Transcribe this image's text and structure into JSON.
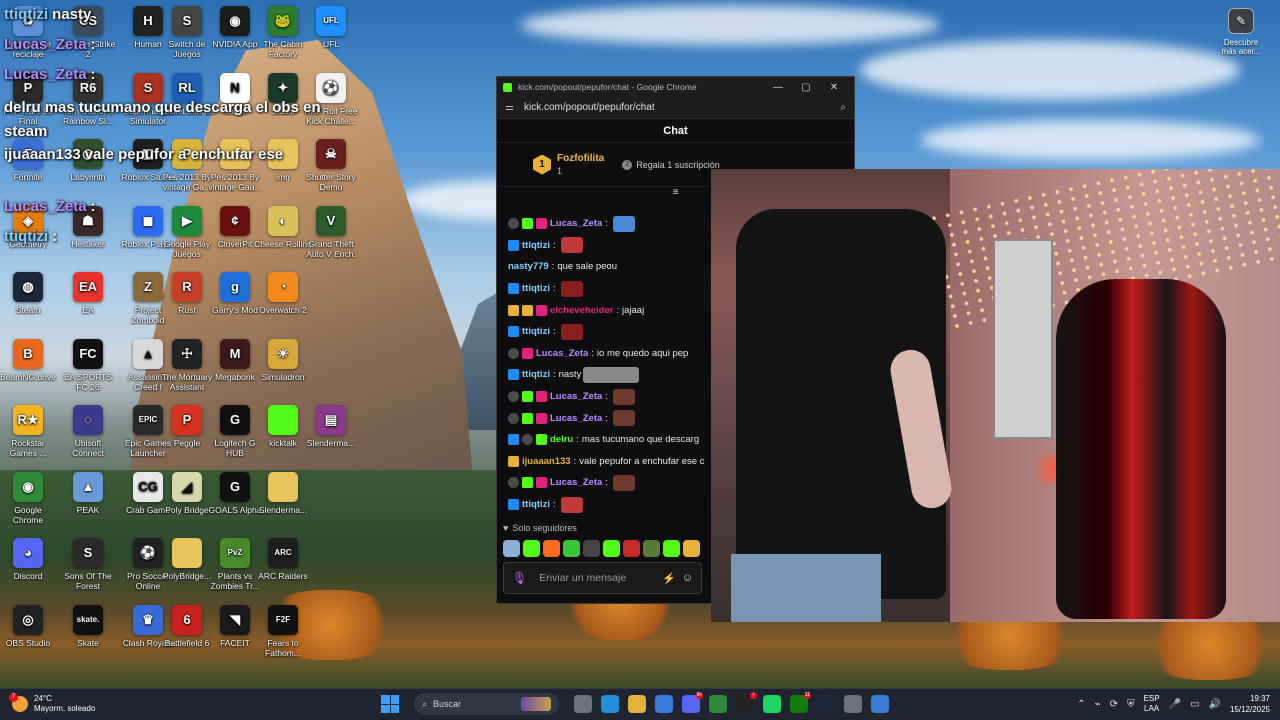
{
  "desktop_icons": [
    {
      "label": "Papelera de reciclaje",
      "icon": "recycle-bin-icon",
      "color": "#5b8fd6",
      "glyph": "♻",
      "col": 0,
      "row": 0
    },
    {
      "label": "Counter-Strike 2",
      "icon": "cs2-icon",
      "color": "#3b4a5c",
      "glyph": "CS",
      "col": 1,
      "row": 0
    },
    {
      "label": "Human",
      "icon": "human-icon",
      "color": "#222222",
      "glyph": "H",
      "col": 2,
      "row": 0
    },
    {
      "label": "Switch de Juegos",
      "icon": "switch-icon",
      "color": "#444444",
      "glyph": "S",
      "col": 2.65,
      "row": 0
    },
    {
      "label": "NVIDIA App",
      "icon": "nvidia-icon",
      "color": "#1c1c1c",
      "glyph": "◉",
      "col": 3.45,
      "row": 0
    },
    {
      "label": "The Cabin Factory",
      "icon": "frog-icon",
      "color": "#2e7a2e",
      "glyph": "🐸",
      "col": 4.25,
      "row": 0
    },
    {
      "label": "UFL",
      "icon": "ufl-icon",
      "color": "#1e90ff",
      "glyph": "UFL",
      "col": 5.05,
      "row": 0
    },
    {
      "label": "PTP Icaro 90 Final",
      "icon": "ptp-icon",
      "color": "#2a2a2a",
      "glyph": "P",
      "col": 0,
      "row": 1
    },
    {
      "label": "Tom Clancy's Rainbow Si...",
      "icon": "rainbow-six-icon",
      "color": "#333333",
      "glyph": "R6",
      "col": 1,
      "row": 1
    },
    {
      "label": "Supermarket Simulator",
      "icon": "supermarket-icon",
      "color": "#aa3322",
      "glyph": "S",
      "col": 2,
      "row": 1
    },
    {
      "label": "Rocket League",
      "icon": "rocket-league-icon",
      "color": "#1d5fb5",
      "glyph": "RL",
      "col": 2.65,
      "row": 1
    },
    {
      "label": "Notion",
      "icon": "notion-icon",
      "color": "#ffffff",
      "glyph": "N",
      "col": 3.45,
      "row": 1
    },
    {
      "label": "Studio",
      "icon": "studio-icon",
      "color": "#1a3a2a",
      "glyph": "✦",
      "col": 4.25,
      "row": 1
    },
    {
      "label": "Kick Roll Free Kick Challe...",
      "icon": "football-icon",
      "color": "#f2f2f2",
      "glyph": "⚽",
      "col": 5.05,
      "row": 1
    },
    {
      "label": "Fortnite",
      "icon": "fortnite-icon",
      "color": "#3b6fd8",
      "glyph": "F",
      "col": 0,
      "row": 2
    },
    {
      "label": "Labyrinth",
      "icon": "labyrinth-icon",
      "color": "#2f4f2f",
      "glyph": "◎",
      "col": 1,
      "row": 2
    },
    {
      "label": "Roblox Studio",
      "icon": "roblox-studio-icon",
      "color": "#1f1f1f",
      "glyph": "◧",
      "col": 2,
      "row": 2
    },
    {
      "label": "Pes 2013 By vintage Ga...",
      "icon": "pes-icon",
      "color": "#d8b33a",
      "glyph": "P",
      "col": 2.65,
      "row": 2
    },
    {
      "label": "Pes 2013 By vintage Gaa...",
      "icon": "folder-icon",
      "color": "#e8c25a",
      "glyph": "",
      "col": 3.45,
      "row": 2
    },
    {
      "label": "img",
      "icon": "folder-icon",
      "color": "#e8c25a",
      "glyph": "",
      "col": 4.25,
      "row": 2
    },
    {
      "label": "Shutter Story Demo",
      "icon": "shutter-story-icon",
      "color": "#6a1e1e",
      "glyph": "☠",
      "col": 5.05,
      "row": 2
    },
    {
      "label": "Geometry",
      "icon": "blender-icon",
      "color": "#e87d0d",
      "glyph": "◈",
      "col": 0,
      "row": 3
    },
    {
      "label": "Helltaker",
      "icon": "hell-icon",
      "color": "#3a2a2a",
      "glyph": "☗",
      "col": 1,
      "row": 3
    },
    {
      "label": "Roblox Player",
      "icon": "roblox-icon",
      "color": "#2b6cf2",
      "glyph": "◼",
      "col": 2,
      "row": 3
    },
    {
      "label": "Google Play Juegos",
      "icon": "google-play-icon",
      "color": "#1e8a3c",
      "glyph": "▶",
      "col": 2.65,
      "row": 3
    },
    {
      "label": "CloverPit",
      "icon": "cloverpit-icon",
      "color": "#6a1010",
      "glyph": "¢",
      "col": 3.45,
      "row": 3
    },
    {
      "label": "Cheese Rolling",
      "icon": "cheese-icon",
      "color": "#d8c05a",
      "glyph": "◐",
      "col": 4.25,
      "row": 3
    },
    {
      "label": "Grand Theft Auto V Ench.",
      "icon": "gta-icon",
      "color": "#2c5a2c",
      "glyph": "V",
      "col": 5.05,
      "row": 3
    },
    {
      "label": "Steam",
      "icon": "steam-icon",
      "color": "#1b2838",
      "glyph": "◍",
      "col": 0,
      "row": 4
    },
    {
      "label": "EA",
      "icon": "ea-icon",
      "color": "#e8332a",
      "glyph": "EA",
      "col": 1,
      "row": 4
    },
    {
      "label": "Project Zomboid",
      "icon": "zomboid-icon",
      "color": "#8a6a3a",
      "glyph": "Z",
      "col": 2,
      "row": 4
    },
    {
      "label": "Rust",
      "icon": "rust-icon",
      "color": "#c8402a",
      "glyph": "R",
      "col": 2.65,
      "row": 4
    },
    {
      "label": "Garry's Mod",
      "icon": "gmod-icon",
      "color": "#1e6fd8",
      "glyph": "g",
      "col": 3.45,
      "row": 4
    },
    {
      "label": "Overwatch 2",
      "icon": "overwatch-icon",
      "color": "#f28a1e",
      "glyph": "◔",
      "col": 4.25,
      "row": 4
    },
    {
      "label": "BeamNG.drive",
      "icon": "beamng-icon",
      "color": "#e8661e",
      "glyph": "B",
      "col": 0,
      "row": 5
    },
    {
      "label": "EA SPORTS FC 26",
      "icon": "fc26-icon",
      "color": "#111111",
      "glyph": "FC",
      "col": 1,
      "row": 5
    },
    {
      "label": "Assassin's Creed I",
      "icon": "assassins-icon",
      "color": "#d8d8d8",
      "glyph": "▲",
      "col": 2,
      "row": 5
    },
    {
      "label": "The Mortuary Assistant",
      "icon": "mortuary-icon",
      "color": "#222222",
      "glyph": "☩",
      "col": 2.65,
      "row": 5
    },
    {
      "label": "Megabonk",
      "icon": "megabonk-icon",
      "color": "#3a1a1a",
      "glyph": "M",
      "col": 3.45,
      "row": 5
    },
    {
      "label": "Simuladron",
      "icon": "simuladron-icon",
      "color": "#d8a83a",
      "glyph": "☀",
      "col": 4.25,
      "row": 5
    },
    {
      "label": "Rockstar Games ...",
      "icon": "rockstar-icon",
      "color": "#f2b41e",
      "glyph": "R★",
      "col": 0,
      "row": 6
    },
    {
      "label": "Ubisoft Connect",
      "icon": "ubisoft-icon",
      "color": "#3a3a8a",
      "glyph": "◌",
      "col": 1,
      "row": 6
    },
    {
      "label": "Epic Games Launcher",
      "icon": "epic-icon",
      "color": "#2a2a2a",
      "glyph": "EPIC",
      "col": 2,
      "row": 6
    },
    {
      "label": "Peggle",
      "icon": "peggle-icon",
      "color": "#d8331e",
      "glyph": "P",
      "col": 2.65,
      "row": 6
    },
    {
      "label": "Logitech G HUB",
      "icon": "logitech-icon",
      "color": "#111111",
      "glyph": "G",
      "col": 3.45,
      "row": 6
    },
    {
      "label": "kicktalk",
      "icon": "kicktalk-icon",
      "color": "#53fc18",
      "glyph": "",
      "col": 4.25,
      "row": 6
    },
    {
      "label": "Slenderma...",
      "icon": "winrar-icon",
      "color": "#8a3a8a",
      "glyph": "▤",
      "col": 5.05,
      "row": 6
    },
    {
      "label": "Google Chrome",
      "icon": "chrome-icon",
      "color": "#2f8a3a",
      "glyph": "◉",
      "col": 0,
      "row": 7
    },
    {
      "label": "PEAK",
      "icon": "peak-icon",
      "color": "#6a9ad8",
      "glyph": "▲",
      "col": 1,
      "row": 7
    },
    {
      "label": "Crab Game",
      "icon": "crab-icon",
      "color": "#e8e8e8",
      "glyph": "CG",
      "col": 2,
      "row": 7
    },
    {
      "label": "Poly Bridge",
      "icon": "poly-bridge-icon",
      "color": "#d8d8b0",
      "glyph": "◢",
      "col": 2.65,
      "row": 7
    },
    {
      "label": "GOALS Alpha",
      "icon": "goals-icon",
      "color": "#111111",
      "glyph": "G",
      "col": 3.45,
      "row": 7
    },
    {
      "label": "Slenderma...",
      "icon": "folder-icon",
      "color": "#e8c25a",
      "glyph": "",
      "col": 4.25,
      "row": 7
    },
    {
      "label": "Discord",
      "icon": "discord-icon",
      "color": "#5865f2",
      "glyph": "◕",
      "col": 0,
      "row": 8
    },
    {
      "label": "Sons Of The Forest",
      "icon": "sons-forest-icon",
      "color": "#2a2a2a",
      "glyph": "S",
      "col": 1,
      "row": 8
    },
    {
      "label": "Pro Soccer Online",
      "icon": "soccer-icon",
      "color": "#222222",
      "glyph": "⚽",
      "col": 2,
      "row": 8
    },
    {
      "label": "PolyBridge...",
      "icon": "folder-icon",
      "color": "#e8c25a",
      "glyph": "",
      "col": 2.65,
      "row": 8
    },
    {
      "label": "Plants vs Zombies Tr...",
      "icon": "pvz-icon",
      "color": "#4a8a2a",
      "glyph": "PvZ",
      "col": 3.45,
      "row": 8
    },
    {
      "label": "ARC Raiders",
      "icon": "arc-raiders-icon",
      "color": "#1e1e1e",
      "glyph": "ARC",
      "col": 4.25,
      "row": 8
    },
    {
      "label": "OBS Studio",
      "icon": "obs-icon",
      "color": "#222222",
      "glyph": "◎",
      "col": 0,
      "row": 9
    },
    {
      "label": "Skate",
      "icon": "skate-icon",
      "color": "#111111",
      "glyph": "skate.",
      "col": 1,
      "row": 9
    },
    {
      "label": "Clash Royale",
      "icon": "clash-royale-icon",
      "color": "#3a6ad8",
      "glyph": "♛",
      "col": 2,
      "row": 9
    },
    {
      "label": "Battlefield 6",
      "icon": "battlefield-icon",
      "color": "#c8201e",
      "glyph": "6",
      "col": 2.65,
      "row": 9
    },
    {
      "label": "FACEIT",
      "icon": "faceit-icon",
      "color": "#1a1a1a",
      "glyph": "◥",
      "col": 3.45,
      "row": 9
    },
    {
      "label": "Fears to Fathom...",
      "icon": "f2f-icon",
      "color": "#111111",
      "glyph": "F2F",
      "col": 4.25,
      "row": 9
    }
  ],
  "corner_icon": {
    "label": "Descubre más acer...",
    "icon": "discover-icon"
  },
  "overlay_chat": [
    {
      "user": "ttiqtizi",
      "text": "nasty",
      "color": "blue"
    },
    {
      "user": "Lucas_Zeta",
      "text": ":",
      "color": "purple"
    },
    {
      "user": "Lucas_Zeta",
      "text": ":",
      "color": "purple"
    },
    {
      "user": "delru",
      "text": "mas tucumano que descarga el obs en steam",
      "color": "white"
    },
    {
      "user": "ijuaaan133",
      "text": "vale pepufor a enchufar ese",
      "color": "white"
    },
    {
      "user": "Lucas_Zeta",
      "text": ":",
      "color": "purple"
    },
    {
      "user": "ttiqtizi",
      "text": ":",
      "color": "blue"
    }
  ],
  "chrome": {
    "title": "kick.com/popout/pepufor/chat - Google Chrome",
    "url": "kick.com/popout/pepufor/chat",
    "header": "Chat",
    "pinned": {
      "name": "Fozfofilita",
      "count": "1",
      "rank": "1",
      "gift_text": "Regala 1 suscripción"
    },
    "messages": [
      {
        "badges": [
          "mod",
          "green",
          "sub"
        ],
        "user": "Lucas_Zeta",
        "user_color": "#b58cff",
        "text": "",
        "emote": "#4a8ad8"
      },
      {
        "badges": [
          "vip"
        ],
        "user": "ttiqtizi",
        "user_color": "#7fd0ff",
        "text": "",
        "emote": "#c03a3a"
      },
      {
        "badges": [],
        "user": "nasty779",
        "user_color": "#7fd0ff",
        "text": "que sale peou",
        "emote": ""
      },
      {
        "badges": [
          "vip"
        ],
        "user": "ttiqtizi",
        "user_color": "#7fd0ff",
        "text": "",
        "emote": "#8a1e1e"
      },
      {
        "badges": [
          "crown",
          "gold",
          "sub"
        ],
        "user": "elcheveheider",
        "user_color": "#e0247c",
        "text": "jajaaj",
        "emote": ""
      },
      {
        "badges": [
          "vip"
        ],
        "user": "ttiqtizi",
        "user_color": "#7fd0ff",
        "text": "",
        "emote": "#8a1e1e"
      },
      {
        "badges": [
          "mod",
          "sub"
        ],
        "user": "Lucas_Zeta",
        "user_color": "#b58cff",
        "text": "io me quedo aqui pep",
        "emote": ""
      },
      {
        "badges": [
          "vip"
        ],
        "user": "ttiqtizi",
        "user_color": "#7fd0ff",
        "text": "nasty",
        "emote": "#8a8a8a"
      },
      {
        "badges": [
          "mod",
          "green",
          "sub"
        ],
        "user": "Lucas_Zeta",
        "user_color": "#b58cff",
        "text": "",
        "emote": "#6a3a2a"
      },
      {
        "badges": [
          "mod",
          "green",
          "sub"
        ],
        "user": "Lucas_Zeta",
        "user_color": "#b58cff",
        "text": "",
        "emote": "#6a3a2a"
      },
      {
        "badges": [
          "vip",
          "mod",
          "green"
        ],
        "user": "delru",
        "user_color": "#53fc18",
        "text": "mas tucumano que descarg",
        "emote": ""
      },
      {
        "badges": [
          "gold"
        ],
        "user": "ijuaaan133",
        "user_color": "#e8b23a",
        "text": "vale pepufor a enchufar ese c",
        "emote": ""
      },
      {
        "badges": [
          "mod",
          "green",
          "sub"
        ],
        "user": "Lucas_Zeta",
        "user_color": "#b58cff",
        "text": "",
        "emote": "#6a3a2a"
      },
      {
        "badges": [
          "vip"
        ],
        "user": "ttiqtizi",
        "user_color": "#7fd0ff",
        "text": "",
        "emote": "#c03a3a"
      }
    ],
    "followers_only": "Solo seguidores",
    "input_placeholder": "Enviar un mensaje"
  },
  "taskbar": {
    "weather_temp": "24°C",
    "weather_desc": "Mayorm. soleado",
    "weather_badge": "7",
    "search_placeholder": "Buscar",
    "lang_top": "ESP",
    "lang_bottom": "LAA",
    "time": "19:37",
    "date": "15/12/2025",
    "apps": [
      {
        "icon": "task-view-icon",
        "color": "#6b7280",
        "badge": ""
      },
      {
        "icon": "edge-icon",
        "color": "#1e8fd8",
        "badge": ""
      },
      {
        "icon": "file-explorer-icon",
        "color": "#e8b23a",
        "badge": ""
      },
      {
        "icon": "store-icon",
        "color": "#3a7ad8",
        "badge": ""
      },
      {
        "icon": "discord-icon",
        "color": "#5865f2",
        "badge": "9+"
      },
      {
        "icon": "chrome-icon",
        "color": "#2f8a3a",
        "badge": ""
      },
      {
        "icon": "github-icon",
        "color": "#222222",
        "badge": "•"
      },
      {
        "icon": "spotify-icon",
        "color": "#1ed760",
        "badge": ""
      },
      {
        "icon": "xbox-icon",
        "color": "#107c10",
        "badge": "11"
      },
      {
        "icon": "steam-icon",
        "color": "#1b2838",
        "badge": ""
      },
      {
        "icon": "settings-icon",
        "color": "#6b7280",
        "badge": ""
      },
      {
        "icon": "obs-icon",
        "color": "#3a7ad8",
        "badge": ""
      }
    ]
  }
}
